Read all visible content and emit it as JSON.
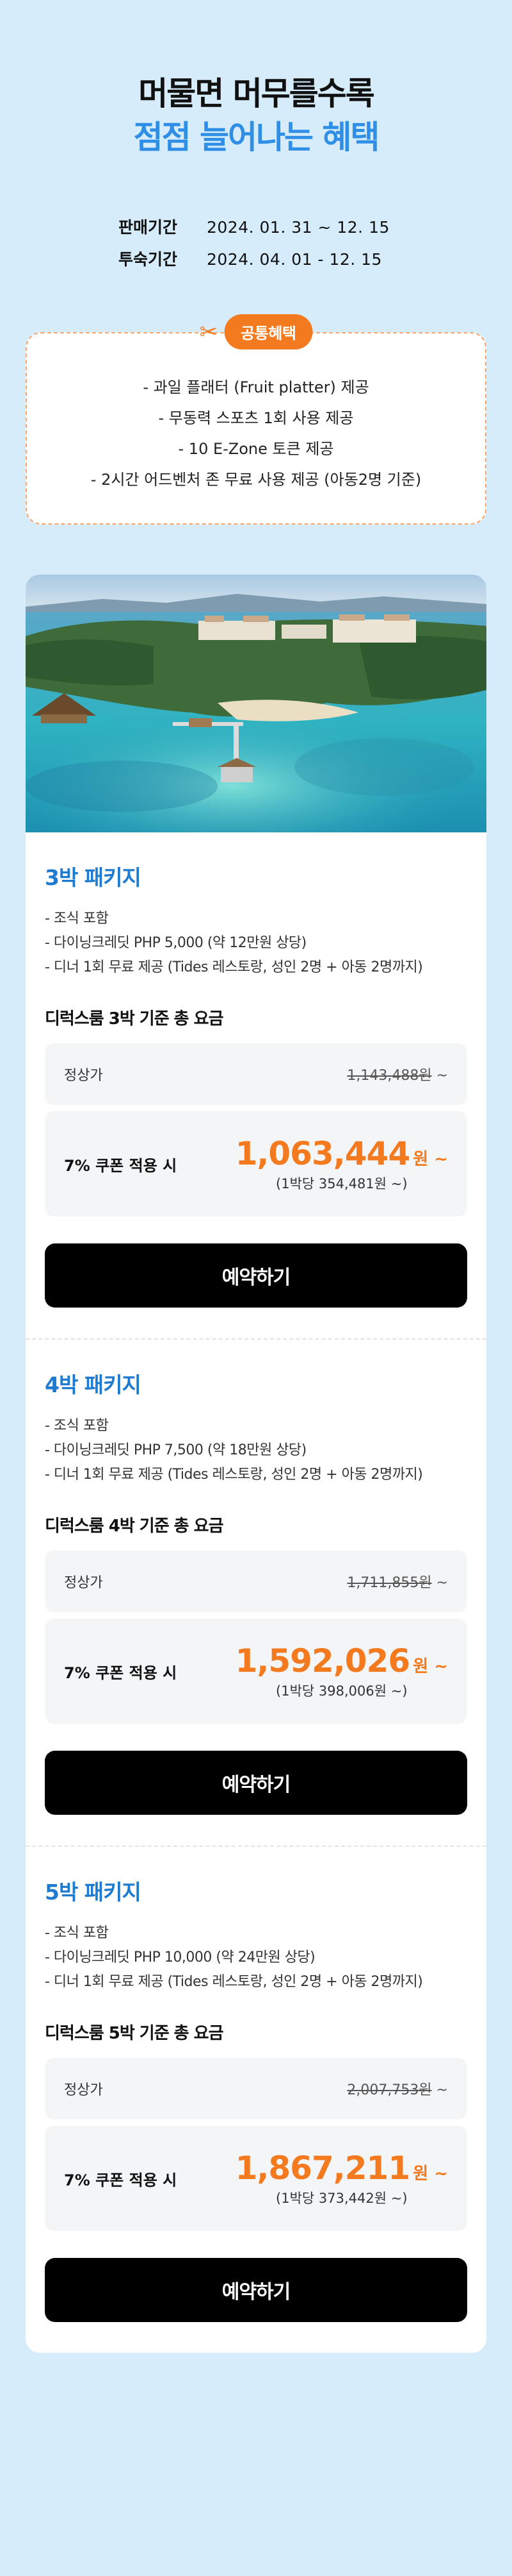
{
  "hero": {
    "line1": "머물면 머무를수록",
    "line2": "점점 늘어나는 혜택"
  },
  "periods": [
    {
      "label": "판매기간",
      "value": "2024. 01. 31 ~ 12. 15"
    },
    {
      "label": "투숙기간",
      "value": "2024. 04. 01 - 12. 15"
    }
  ],
  "benefits": {
    "tag": "공통혜택",
    "icon": "scissors-icon",
    "items": [
      "- 과일 플래터 (Fruit platter) 제공",
      "- 무동력 스포츠 1회 사용 제공",
      "- 10 E-Zone 토큰 제공",
      "- 2시간 어드벤처 존 무료 사용 제공 (아동2명 기준)"
    ]
  },
  "packages": [
    {
      "title": "3박 패키지",
      "features": [
        "- 조식 포함",
        "- 다이닝크레딧 PHP 5,000 (약 12만원 상당)",
        "- 디너 1회 무료 제공 (Tides 레스토랑, 성인 2명 + 아동 2명까지)"
      ],
      "rate_title": "디럭스룸 3박 기준 총 요금",
      "regular_label": "정상가",
      "regular_price": "1,143,488원",
      "regular_suffix": " ~",
      "coupon_label": "7% 쿠폰 적용 시",
      "coupon_price": "1,063,444",
      "coupon_unit": "원 ~",
      "per_night": "(1박당 354,481원 ~)",
      "button": "예약하기"
    },
    {
      "title": "4박 패키지",
      "features": [
        "- 조식 포함",
        "- 다이닝크레딧 PHP 7,500 (약 18만원 상당)",
        "- 디너 1회 무료 제공 (Tides 레스토랑, 성인 2명 + 아동 2명까지)"
      ],
      "rate_title": "디럭스룸 4박 기준 총 요금",
      "regular_label": "정상가",
      "regular_price": "1,711,855원",
      "regular_suffix": " ~",
      "coupon_label": "7% 쿠폰 적용 시",
      "coupon_price": "1,592,026",
      "coupon_unit": "원 ~",
      "per_night": "(1박당 398,006원 ~)",
      "button": "예약하기"
    },
    {
      "title": "5박 패키지",
      "features": [
        "- 조식 포함",
        "- 다이닝크레딧 PHP 10,000 (약 24만원 상당)",
        "- 디너 1회 무료 제공 (Tides 레스토랑, 성인 2명 + 아동 2명까지)"
      ],
      "rate_title": "디럭스룸 5박 기준 총 요금",
      "regular_label": "정상가",
      "regular_price": "2,007,753원",
      "regular_suffix": " ~",
      "coupon_label": "7% 쿠폰 적용 시",
      "coupon_price": "1,867,211",
      "coupon_unit": "원 ~",
      "per_night": "(1박당 373,442원 ~)",
      "button": "예약하기"
    }
  ],
  "colors": {
    "background": "#d6ecfb",
    "accent_blue": "#2f8fe6",
    "title_blue": "#1f7bd0",
    "accent_orange": "#f47a1f",
    "button": "#000000"
  }
}
